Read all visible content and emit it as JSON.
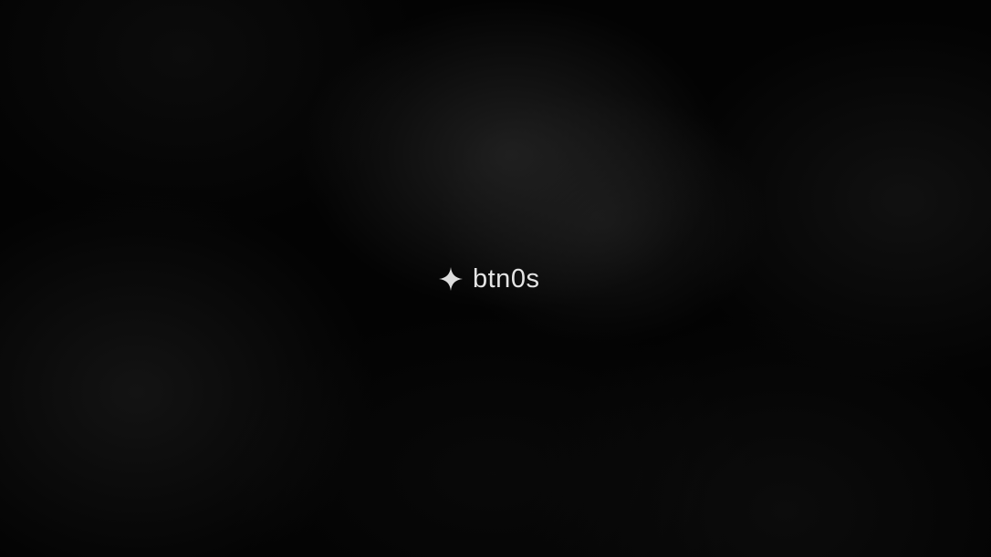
{
  "brand": {
    "name": "btn0s",
    "icon": "sparkle-icon"
  },
  "colors": {
    "background": "#000000",
    "text": "#e4e4e4"
  }
}
